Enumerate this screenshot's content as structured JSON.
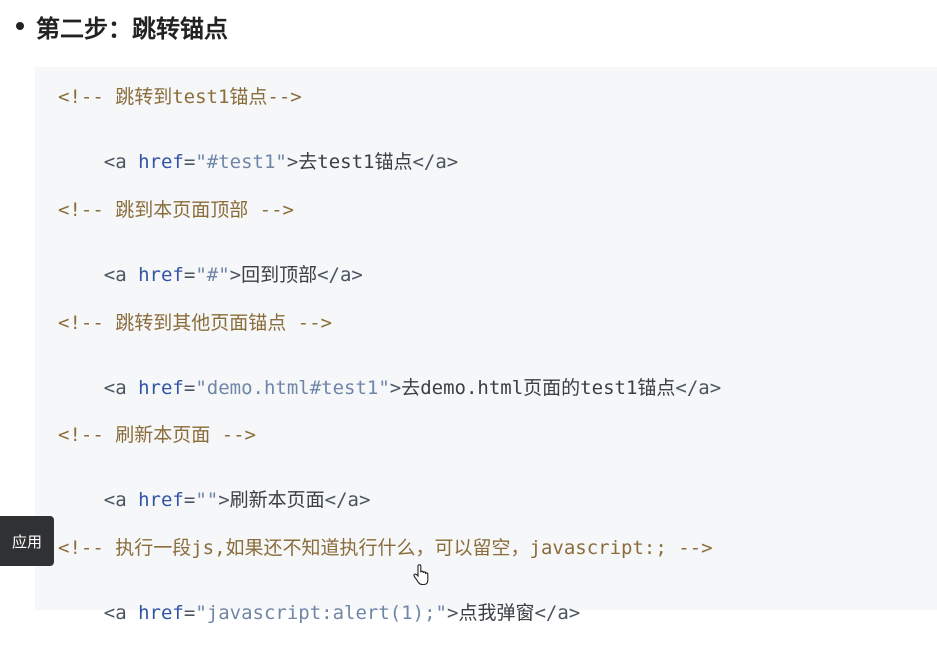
{
  "heading": {
    "text": "第二步：跳转锚点"
  },
  "code": {
    "l1": {
      "comment": "<!-- 跳转到test1锚点-->"
    },
    "l2": {
      "open": "<a ",
      "attr": "href",
      "eq": "=",
      "val": "\"#test1\"",
      "close": ">",
      "text": "去test1锚点",
      "end": "</a>"
    },
    "l3": {
      "comment": "<!-- 跳到本页面顶部 -->"
    },
    "l4": {
      "open": "<a ",
      "attr": "href",
      "eq": "=",
      "val": "\"#\"",
      "close": ">",
      "text": "回到顶部",
      "end": "</a>"
    },
    "l5": {
      "comment": "<!-- 跳转到其他页面锚点 -->"
    },
    "l6": {
      "open": "<a ",
      "attr": "href",
      "eq": "=",
      "val": "\"demo.html#test1\"",
      "close": ">",
      "text": "去demo.html页面的test1锚点",
      "end": "</a>"
    },
    "l7": {
      "comment": "<!-- 刷新本页面 -->"
    },
    "l8": {
      "open": "<a ",
      "attr": "href",
      "eq": "=",
      "val": "\"\"",
      "close": ">",
      "text": "刷新本页面",
      "end": "</a>"
    },
    "l9": {
      "comment": "<!-- 执行一段js,如果还不知道执行什么，可以留空，javascript:; -->"
    },
    "l10": {
      "open": "<a ",
      "attr": "href",
      "eq": "=",
      "val": "\"javascript:alert(1);\"",
      "close": ">",
      "text": "点我弹窗",
      "end": "</a>"
    }
  },
  "tooltip": {
    "label": "应用"
  },
  "icons": {
    "cursor": "hand-pointer-icon"
  }
}
